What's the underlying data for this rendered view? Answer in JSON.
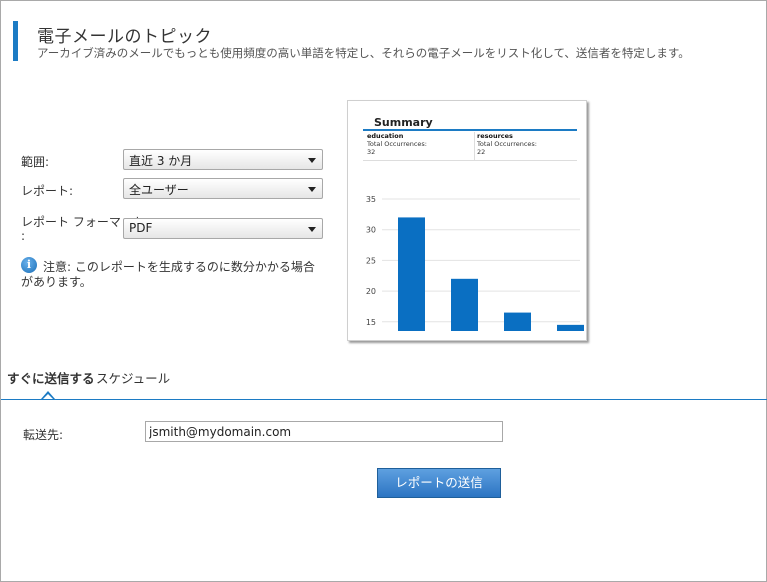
{
  "header": {
    "title": "電子メールのトピック",
    "subtitle": "アーカイブ済みのメールでもっとも使用頻度の高い単語を特定し、それらの電子メールをリスト化して、送信者を特定します。"
  },
  "form": {
    "range_label": "範囲:",
    "range_value": "直近 3 か月",
    "report_label": "レポート:",
    "report_value": "全ユーザー",
    "format_label_line1": "レポート フォーマット",
    "format_label_line2": ":",
    "format_value": "PDF",
    "note": "注意: このレポートを生成するのに数分かかる場合があります。"
  },
  "preview": {
    "title": "Summary",
    "columns": [
      {
        "name": "education",
        "caption": "Total Occurrences:",
        "value": "32"
      },
      {
        "name": "resources",
        "caption": "Total Occurrences:",
        "value": "22"
      }
    ]
  },
  "chart_data": {
    "type": "bar",
    "values": [
      32,
      22,
      16.5,
      14.5
    ],
    "ylim": [
      13.5,
      35
    ],
    "yticks": [
      "35",
      "30",
      "25",
      "20",
      "15"
    ],
    "ytick_values": [
      35,
      30,
      25,
      20,
      15
    ],
    "bar_color": "#0a6fc2",
    "grid": true
  },
  "tabs": [
    {
      "label": "すぐに送信する",
      "active": true
    },
    {
      "label": "スケジュール",
      "active": false
    }
  ],
  "send": {
    "to_label": "転送先:",
    "to_value": "jsmith@mydomain.com",
    "button_label": "レポートの送信"
  },
  "colors": {
    "accent": "#1c7bc4"
  }
}
